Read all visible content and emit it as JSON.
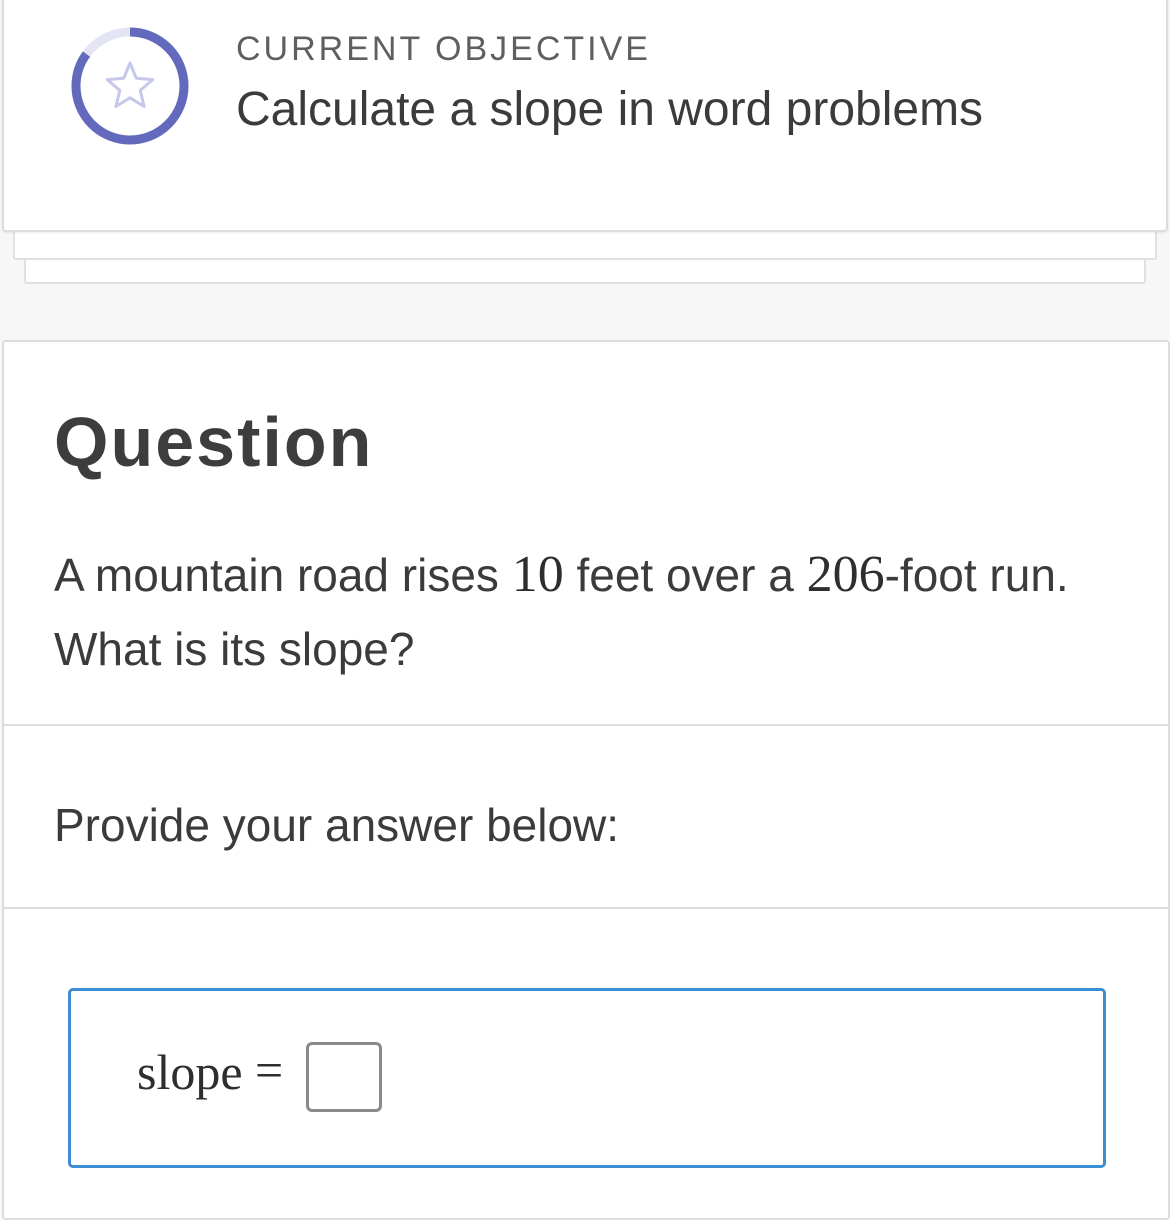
{
  "objective": {
    "label": "CURRENT OBJECTIVE",
    "title": "Calculate a slope in word problems",
    "icon": "star-icon",
    "progress_fraction": 0.85,
    "progress_color": "#6369bd",
    "progress_track_color": "#e4e5f4",
    "star_color": "#c6c8ea"
  },
  "question": {
    "heading": "Question",
    "text_part1": "A mountain road rises ",
    "rise_value": "10",
    "text_part2": " feet over a ",
    "run_value": "206",
    "text_part3": "-foot run. What is its slope?"
  },
  "answer": {
    "prompt": "Provide your answer below:",
    "variable_label": "slope",
    "equals": "=",
    "input_value": "",
    "accent_color": "#3b8ed3"
  }
}
